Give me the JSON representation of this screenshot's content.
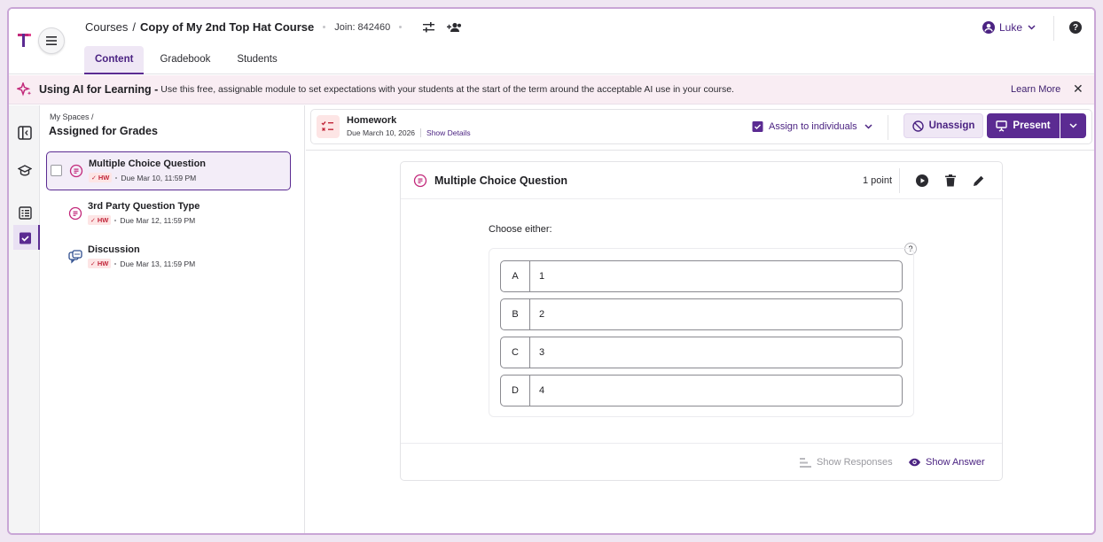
{
  "header": {
    "breadcrumb_root": "Courses",
    "breadcrumb_sep": "/",
    "course_title": "Copy of My 2nd Top Hat Course",
    "join_code": "Join: 842460",
    "tabs": [
      {
        "label": "Content",
        "active": true
      },
      {
        "label": "Gradebook",
        "active": false
      },
      {
        "label": "Students",
        "active": false
      }
    ],
    "user_name": "Luke",
    "help_glyph": "?"
  },
  "banner": {
    "title": "Using AI for Learning -",
    "text": "Use this free, assignable module to set expectations with your students at the start of the term around the acceptable AI use in your course.",
    "learn_more": "Learn More",
    "close_glyph": "✕"
  },
  "sidebar": {
    "breadcrumb": "My Spaces /",
    "heading": "Assigned for Grades",
    "items": [
      {
        "title": "Multiple Choice Question",
        "badge": "HW",
        "due": "Due Mar 10, 11:59 PM",
        "selected": true,
        "icon": "question-bubble-icon"
      },
      {
        "title": "3rd Party Question Type",
        "badge": "HW",
        "due": "Due Mar 12, 11:59 PM",
        "selected": false,
        "icon": "question-bubble-icon"
      },
      {
        "title": "Discussion",
        "badge": "HW",
        "due": "Due Mar 13, 11:59 PM",
        "selected": false,
        "icon": "discussion-icon"
      }
    ]
  },
  "toolbar": {
    "name": "Homework",
    "due": "Due March 10, 2026",
    "show_details": "Show Details",
    "assign_label": "Assign to individuals",
    "unassign_label": "Unassign",
    "present_label": "Present"
  },
  "question": {
    "title": "Multiple Choice Question",
    "points": "1 point",
    "prompt": "Choose either:",
    "help_glyph": "?",
    "options": [
      {
        "letter": "A",
        "text": "1"
      },
      {
        "letter": "B",
        "text": "2"
      },
      {
        "letter": "C",
        "text": "3"
      },
      {
        "letter": "D",
        "text": "4"
      }
    ],
    "show_responses": "Show Responses",
    "show_answer": "Show Answer"
  },
  "colors": {
    "brand": "#5b2b92",
    "hw_badge_bg": "#fde5e5",
    "hw_badge_fg": "#c2273b",
    "banner_bg": "#f9edf3"
  }
}
